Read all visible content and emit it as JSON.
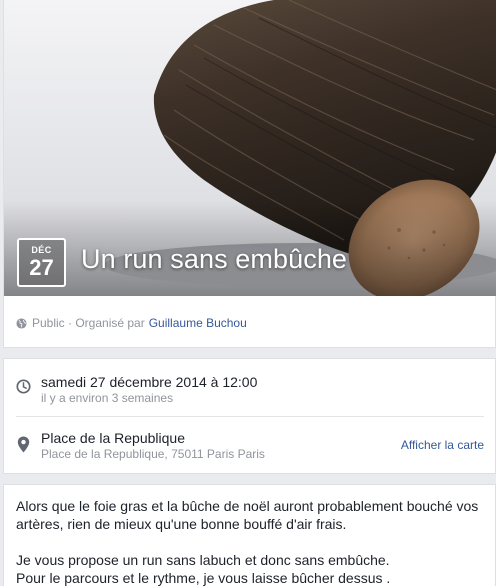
{
  "event": {
    "month": "DÉC",
    "day": "27",
    "title": "Un run sans embûche",
    "privacy": "Public · Organisé par",
    "organizer": "Guillaume Buchou"
  },
  "details": {
    "datetime": "samedi 27 décembre 2014 à 12:00",
    "relative_time": "il y a environ 3 semaines",
    "place_name": "Place de la Republique",
    "place_address": "Place de la Republique, 75011 Paris Paris",
    "map_link": "Afficher la carte"
  },
  "description": {
    "line1": "Alors que le foie gras et la bûche de noël auront probablement bouché vos",
    "line2": "artères, rien de mieux qu'une bonne bouffé d'air frais.",
    "line3": "Je vous propose un run sans labuch et donc sans embûche.",
    "line4": "Pour le parcours et le rythme, je vous laisse bûcher dessus ."
  },
  "icons": {
    "privacy": "globe-icon",
    "time": "clock-icon",
    "place": "map-pin-icon"
  },
  "colors": {
    "link": "#365899",
    "secondary_text": "#90949c",
    "page_background": "#e9ebee"
  }
}
